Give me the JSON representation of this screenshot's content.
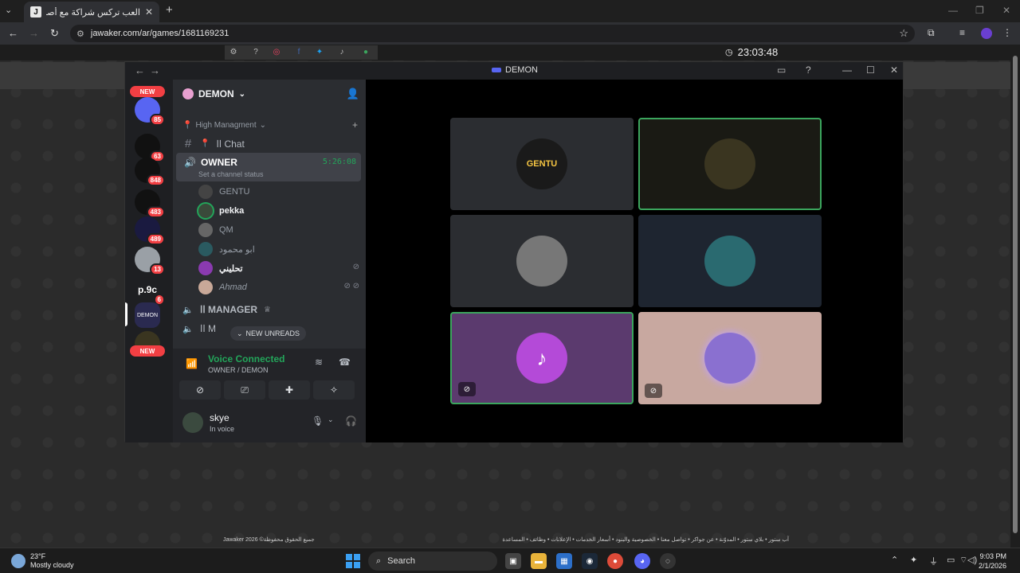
{
  "browser": {
    "tab_title": "العب تركس شراكة مع أصدقائك",
    "tab_favicon": "J",
    "url": "jawaker.com/ar/games/1681169231"
  },
  "page": {
    "clock": "23:03:48",
    "footer_left": "Jawaker 2026 ©جميع الحقوق محفوظة",
    "footer_right": "آب ستور • بلاي ستور • المدوّنة • عن جواكر • تواصل معنا • الخصوصية والبنود • أسعار الخدمات • الإعلانات • وظائف • المساعدة"
  },
  "discord": {
    "window_title": "DEMON",
    "server_name": "DEMON",
    "servers": [
      {
        "label": "",
        "badge": "85"
      },
      {
        "label": "",
        "badge": "63"
      },
      {
        "label": "",
        "badge": "848"
      },
      {
        "label": "",
        "badge": "483"
      },
      {
        "label": "",
        "badge": "489"
      },
      {
        "label": "",
        "badge": "13"
      },
      {
        "label": "p.9c",
        "badge": "6"
      },
      {
        "label": "DEMON",
        "badge": ""
      }
    ],
    "new_label": "NEW",
    "category": "High Managment",
    "chat_channel": "اا Chat",
    "active_channel": {
      "name": "OWNER",
      "timer": "5:26:08",
      "status": "Set a channel status"
    },
    "voice_users": [
      {
        "name": "GENTU",
        "bright": false
      },
      {
        "name": "pekka",
        "bright": true
      },
      {
        "name": "QM",
        "bright": false
      },
      {
        "name": "ابو محمود",
        "bright": false
      },
      {
        "name": "تحليني",
        "bright": true
      },
      {
        "name": "Ahmad",
        "bright": false
      }
    ],
    "manager_channel": "اا MANAGER",
    "next_channel": "اا M",
    "new_unreads": "NEW UNREADS",
    "voice_panel": {
      "status": "Voice Connected",
      "sub": "OWNER / DEMON"
    },
    "user": {
      "name": "skye",
      "status": "In voice"
    },
    "tiles": [
      {
        "label": "GENTU",
        "speaking": false,
        "bg": "#2b2d31",
        "avatar_bg": "#1a1a1a"
      },
      {
        "label": "",
        "speaking": true,
        "bg": "#1a1a14",
        "avatar_bg": "#3a3520"
      },
      {
        "label": "",
        "speaking": false,
        "bg": "#2b2d31",
        "avatar_bg": "#777"
      },
      {
        "label": "",
        "speaking": false,
        "bg": "#1e2530",
        "avatar_bg": "#2a6a70"
      },
      {
        "label": "",
        "speaking": true,
        "bg": "#5b3a6e",
        "avatar_bg": "#b44ad8",
        "muted": true
      },
      {
        "label": "",
        "speaking": false,
        "bg": "#c8a8a0",
        "avatar_bg": "#8a70d0",
        "muted": true
      }
    ]
  },
  "taskbar": {
    "temp": "23°F",
    "weather": "Mostly cloudy",
    "search": "Search",
    "time": "9:03 PM",
    "date": "2/1/2026"
  }
}
